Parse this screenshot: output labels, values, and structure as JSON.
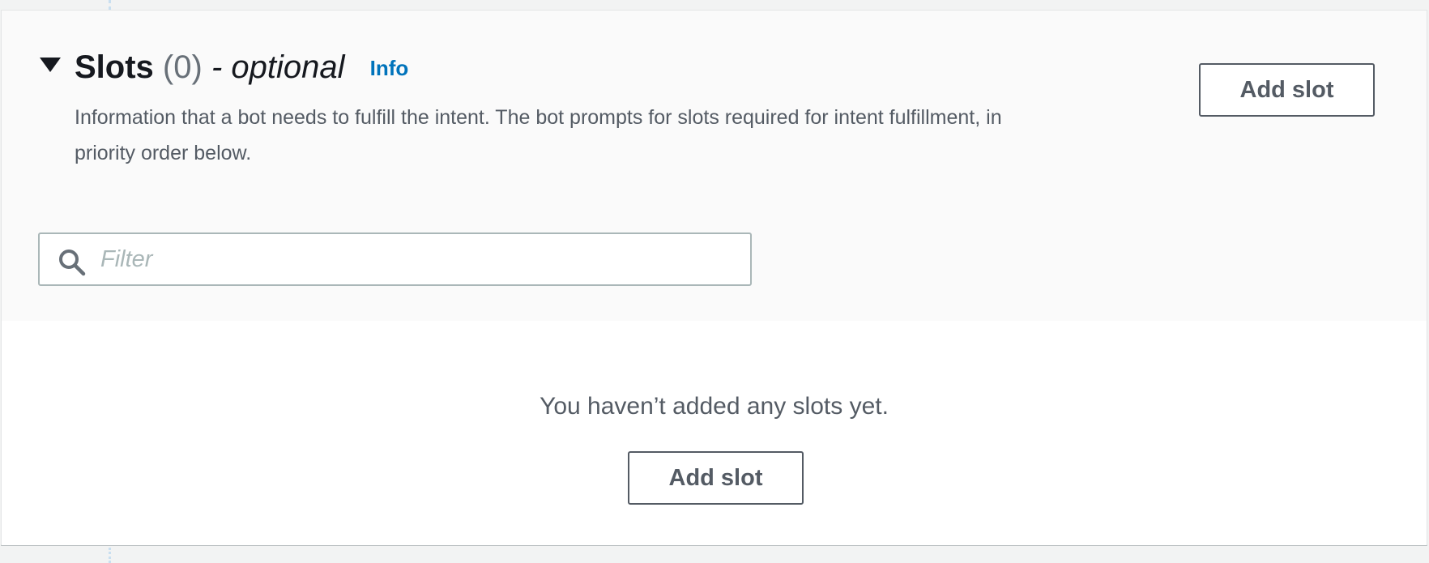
{
  "section": {
    "title": "Slots",
    "count": "(0)",
    "optional": "- optional",
    "info_link": "Info",
    "description": "Information that a bot needs to fulfill the intent. The bot prompts for slots required for intent fulfillment, in priority order below.",
    "add_button": "Add slot"
  },
  "filter": {
    "placeholder": "Filter",
    "value": ""
  },
  "empty_state": {
    "message": "You haven’t added any slots yet.",
    "add_button": "Add slot"
  },
  "icons": {
    "collapse": "caret-down-icon",
    "search": "search-icon"
  },
  "colors": {
    "link": "#0073bb",
    "text": "#16191f",
    "muted_text": "#545b64",
    "border": "#aab7b8"
  }
}
